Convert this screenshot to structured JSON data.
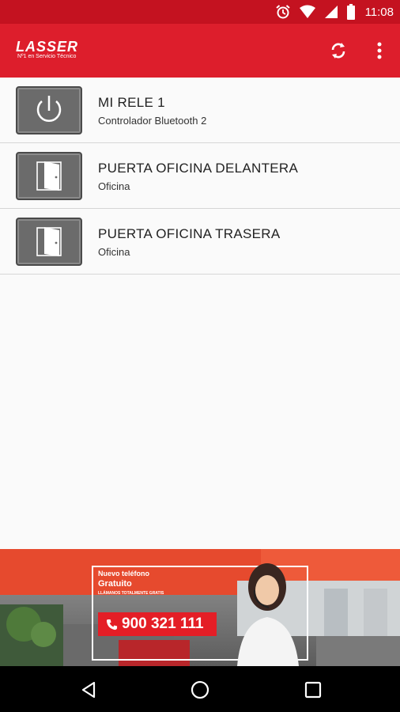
{
  "status_bar": {
    "time": "11:08"
  },
  "app_bar": {
    "logo_text": "LASSER",
    "logo_tagline": "Nº1 en Servicio Técnico",
    "actions": [
      "sync-icon",
      "more-vert-icon"
    ]
  },
  "devices": [
    {
      "name": "MI RELE 1",
      "subtitle": "Controlador Bluetooth 2",
      "icon": "power-icon"
    },
    {
      "name": "PUERTA OFICINA DELANTERA",
      "subtitle": "Oficina",
      "icon": "door-icon"
    },
    {
      "name": "PUERTA OFICINA TRASERA",
      "subtitle": "Oficina",
      "icon": "door-icon"
    }
  ],
  "ad_banner": {
    "headline": "Nuevo teléfono",
    "subheadline": "Gratuito",
    "tagline": "LLÁMANOS TOTALMENTE GRATIS",
    "phone": "900 321 111"
  },
  "nav_bar": {
    "buttons": [
      "back-icon",
      "home-icon",
      "recents-icon"
    ]
  },
  "colors": {
    "status_bar": "#c41220",
    "app_bar": "#dd1e2c",
    "tile": "#6b6b6b",
    "ad_red": "#e41e26"
  }
}
